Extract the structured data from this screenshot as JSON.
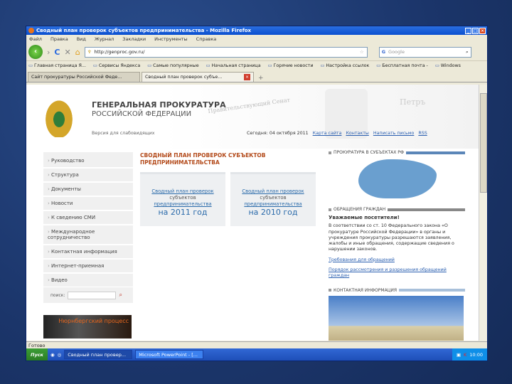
{
  "window": {
    "title": "Сводный план проверок субъектов предпринимательства - Mozilla Firefox"
  },
  "menu": [
    "Файл",
    "Правка",
    "Вид",
    "Журнал",
    "Закладки",
    "Инструменты",
    "Справка"
  ],
  "url": "http://genproc.gov.ru/",
  "search_value": "Google",
  "bookmarks": [
    "Главная страница Я...",
    "Сервисы Яндекса",
    "Самые популярные",
    "Начальная страница",
    "Горячие новости",
    "Настройка ссылок",
    "Бесплатная почта -",
    "Windows"
  ],
  "tabs": [
    "Сайт прокуратуры Российской Феде...",
    "Сводный план проверок субъе..."
  ],
  "header": {
    "title": "ГЕНЕРАЛЬНАЯ ПРОКУРАТУРА",
    "subtitle": "РОССИЙСКОЙ ФЕДЕРАЦИИ",
    "stamp": "Правительствующий Сенат",
    "petr": "Петръ",
    "sub": "Версия для слабовидящих",
    "date": "Сегодня: 04 октября 2011",
    "links": [
      "Карта сайта",
      "Контакты",
      "Написать письмо",
      "RSS"
    ]
  },
  "leftnav": [
    "Руководство",
    "Структура",
    "Документы",
    "Новости",
    "К сведению СМИ",
    "Международное сотрудничество",
    "Контактная информация",
    "Интернет-приемная",
    "Видео"
  ],
  "content": {
    "title": "СВОДНЫЙ ПЛАН ПРОВЕРОК СУБЪЕКТОВ ПРЕДПРИНИМАТЕЛЬСТВА",
    "cards": [
      {
        "l1": "Сводный план проверок",
        "l2": "субъектов",
        "l3": "предпринимательства",
        "yr": "на 2011 год"
      },
      {
        "l1": "Сводный план проверок",
        "l2": "субъектов",
        "l3": "предпринимательства",
        "yr": "на 2010 год"
      }
    ]
  },
  "right": {
    "s1": "ПРОКУРАТУРА В СУБЪЕКТАХ РФ",
    "s2": "ОБРАЩЕНИЯ ГРАЖДАН",
    "greet": "Уважаемые посетители!",
    "text": "В соответствии со ст. 10 Федерального закона «О прокуратуре Российской Федерации» в органы и учреждения прокуратуры разрешаются заявления, жалобы и иные обращения, содержащие сведения о нарушении законов.",
    "link1": "Требования для обращений",
    "link2": "Порядок рассмотрения и разрешения обращений граждан",
    "s3": "КОНТАКТНАЯ ИНФОРМАЦИЯ"
  },
  "search_label": "поиск:",
  "banner": "Нюрнбергский процесс",
  "status": "Готово",
  "taskbar": {
    "start": "Пуск",
    "tasks": [
      "Сводный план провер...",
      "Microsoft PowerPoint - [..."
    ],
    "clock": "10:00"
  }
}
